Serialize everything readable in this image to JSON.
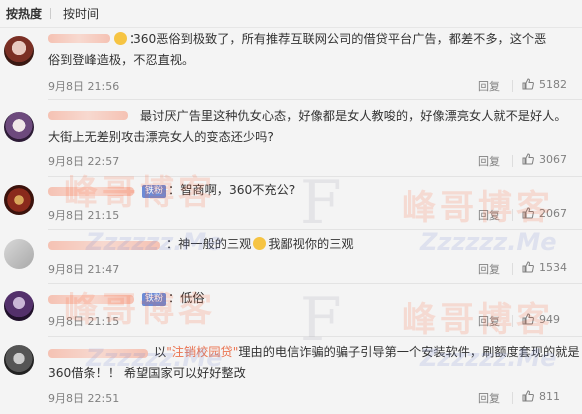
{
  "sort": {
    "hot": "按热度",
    "time": "按时间"
  },
  "actions": {
    "reply": "回复"
  },
  "comments": [
    {
      "avatar": "avatar-user-1",
      "prefix": "：",
      "text_line1": "360恶俗到极致了，所有推荐互联网公司的借贷平台广告，都差不多，这个恶",
      "text_line2": "俗到登峰造极，不忍直视。",
      "time": "9月8日 21:56",
      "likes": "5182"
    },
    {
      "avatar": "avatar-user-2",
      "text_line1": "最讨厌广告里这种仇女心态，好像都是女人教唆的，好像漂亮女人就不是好人。",
      "text_line2": "大街上无差别攻击漂亮女人的变态还少吗?",
      "time": "9月8日 22:57",
      "likes": "3067"
    },
    {
      "avatar": "avatar-user-3",
      "badge": "铁粉",
      "text": "：智商啊，360不充公?",
      "time": "9月8日 21:15",
      "likes": "2067"
    },
    {
      "avatar": "avatar-user-4",
      "text_a": "：神一般的三观",
      "text_b": "我鄙视你的三观",
      "time": "9月8日 21:47",
      "likes": "1534"
    },
    {
      "avatar": "avatar-user-5",
      "badge": "铁粉",
      "text": "：低俗",
      "time": "9月8日 21:15",
      "likes": "949"
    },
    {
      "avatar": "avatar-user-6",
      "text_line1_a": "以",
      "text_line1_hl": "\"注销校园贷\"",
      "text_line1_b": "理由的电信诈骗的骗子引导第一个安装软件，刷额度套现的就是",
      "text_line2": "360借条！！ 希望国家可以好好整改",
      "time": "9月8日 22:51",
      "likes": "811"
    }
  ],
  "watermark": {
    "cn": "峰哥博客",
    "en": "Zzzzzz.Me",
    "letter": "F"
  },
  "colors": {
    "accent": "#eb7350",
    "muted": "#808080",
    "background": "#f4f4f4",
    "badge": "#6c8bd6"
  }
}
